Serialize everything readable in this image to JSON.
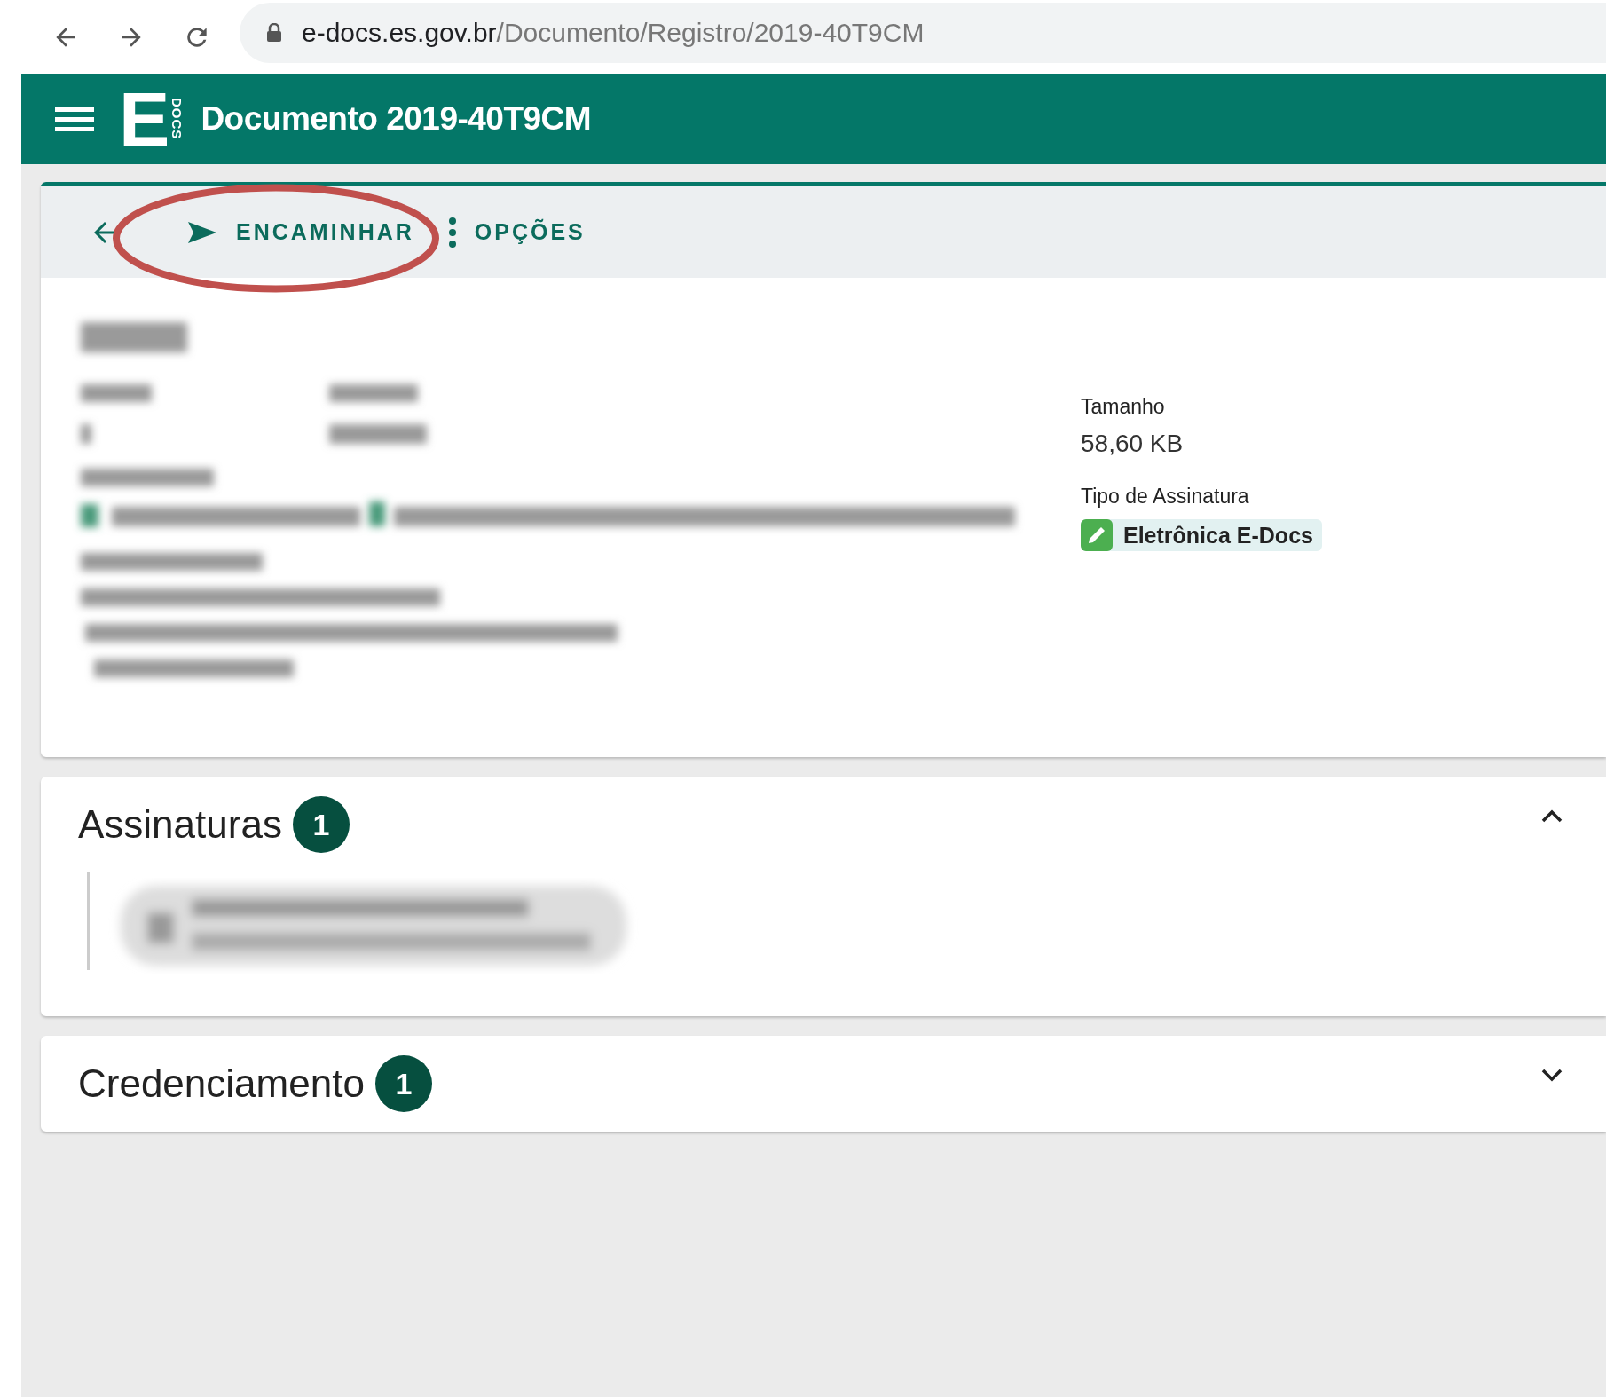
{
  "browser": {
    "url_host": "e-docs.es.gov.br",
    "url_path": "/Documento/Registro/2019-40T9CM"
  },
  "app_bar": {
    "title": "Documento 2019-40T9CM",
    "logo_letter": "E",
    "logo_sub": "DOCS"
  },
  "toolbar": {
    "actions": [
      {
        "kind": "forward",
        "label": "ENCAMINHAR",
        "highlighted": true
      },
      {
        "kind": "options",
        "label": "OPÇÕES",
        "highlighted": false
      }
    ]
  },
  "details": {
    "fields": [
      {
        "label": "Tamanho",
        "value": "58,60 KB",
        "kind": "text"
      },
      {
        "label": "Tipo de Assinatura",
        "value": "Eletrônica E-Docs",
        "kind": "chip"
      }
    ]
  },
  "panels": [
    {
      "title": "Assinaturas",
      "count": "1",
      "expanded": true
    },
    {
      "title": "Credenciamento",
      "count": "1",
      "expanded": false
    }
  ]
}
